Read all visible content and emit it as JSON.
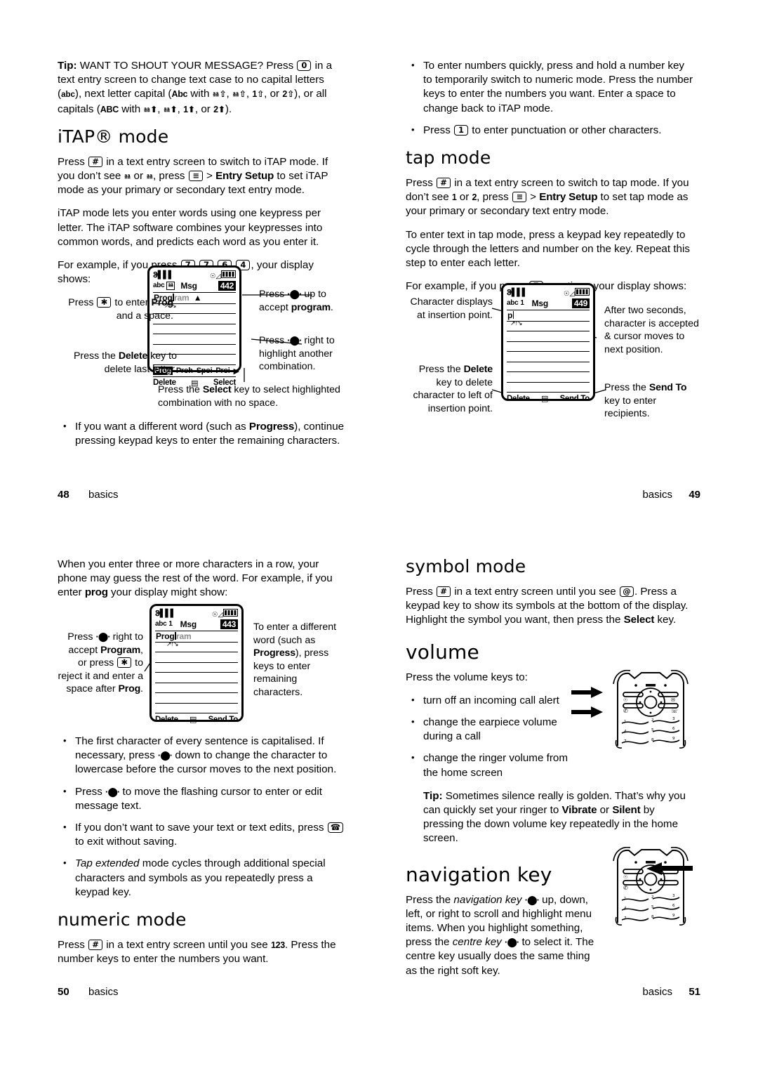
{
  "pages": [
    {
      "left": {
        "tip_label": "Tip:",
        "tip_text_1": " WANT TO SHOUT YOUR MESSAGE? Press ",
        "tip_key_0": "0",
        "tip_text_2": " in a text entry screen to change text case to no capital letters (",
        "tip_abc": "abc",
        "tip_text_3": "), next letter capital (",
        "tip_Abc": "Abc",
        "tip_text_4": " with ",
        "tip_text_5": "), or all capitals (",
        "tip_ABC": "ABC",
        "tip_text_6": " with ",
        "tip_text_7": ").",
        "heading_itap": "iTAP® mode",
        "p1_a": "Press ",
        "p1_key_hash": "#",
        "p1_b": " in a text entry screen to switch to iTAP mode. If you don’t see ",
        "p1_c": " or ",
        "p1_d": ", press ",
        "p1_menu": "☰",
        "p1_e": " > ",
        "p1_entrysetup": "Entry Setup",
        "p1_f": " to set iTAP mode as your primary or secondary text entry mode.",
        "p2": "iTAP mode lets you enter words using one keypress per letter. The iTAP software combines your keypresses into common words, and predicts each word as you enter it.",
        "p3_a": "For example, if you press ",
        "p3_keys": [
          "7",
          "7",
          "6",
          "4"
        ],
        "p3_b": ", your display shows:",
        "figure": {
          "status_signal": "ᴵ▂▄▆",
          "status_alert": "♩◀))",
          "mode": "abc",
          "mode_icon": "iTAP",
          "msg_label": "Msg",
          "char_count": "442",
          "typed_text": "Prog",
          "predicted_text": "ram",
          "word_list": [
            "Prog",
            "Proh",
            "Spoi",
            "Proi"
          ],
          "word_list_selected": "Prog",
          "softkey_left": "Delete",
          "softkey_right": "Select",
          "callout_left_top_a": "Press ",
          "callout_left_top_key": "✱",
          "callout_left_top_b": " to enter ",
          "callout_left_top_bold": "Prog",
          "callout_left_top_c": " and a space.",
          "callout_left_bottom_a": "Press the ",
          "callout_left_bottom_bold": "Delete",
          "callout_left_bottom_b": " key to delete last letter.",
          "callout_right_top_a": "Press ",
          "callout_right_top_b": " up to accept ",
          "callout_right_top_bold": "program",
          "callout_right_top_c": ".",
          "callout_right_mid_a": "Press ",
          "callout_right_mid_b": " right to highlight another combination.",
          "callout_bottom_a": "Press the ",
          "callout_bottom_bold": "Select",
          "callout_bottom_b": " key to select highlighted combination with no space."
        },
        "bullet1_a": "If you want a different word (such as ",
        "bullet1_bold": "Progress",
        "bullet1_b": "), continue pressing keypad keys to enter the remaining characters."
      },
      "right": {
        "bullet1": "To enter numbers quickly, press and hold a number key to temporarily switch to numeric mode. Press the number keys to enter the numbers you want. Enter a space to change back to iTAP mode.",
        "bullet2_a": "Press ",
        "bullet2_key": "1",
        "bullet2_b": " to enter punctuation or other characters.",
        "heading_tap": "tap mode",
        "p1_a": "Press ",
        "p1_key_hash": "#",
        "p1_b": " in a text entry screen to switch to tap mode. If you don’t see ",
        "p1_one": "1",
        "p1_c": " or ",
        "p1_two": "2",
        "p1_d": ", press ",
        "p1_e": " > ",
        "p1_entrysetup": "Entry Setup",
        "p1_f": " to set tap mode as your primary or secondary text entry mode.",
        "p2": "To enter text in tap mode, press a keypad key repeatedly to cycle through the letters and number on the key. Repeat this step to enter each letter.",
        "p3_a": "For example, if you press ",
        "p3_key": "7",
        "p3_b": " one time, your display shows:",
        "figure": {
          "mode": "abc",
          "mode_icon": "1",
          "msg_label": "Msg",
          "char_count": "449",
          "typed_text": "p",
          "softkey_left": "Delete",
          "softkey_right": "Send To",
          "callout_left_top": "Character displays at insertion point.",
          "callout_left_bottom_a": "Press the ",
          "callout_left_bottom_bold": "Delete",
          "callout_left_bottom_b": " key to delete character to left of insertion point.",
          "callout_right_top": "After two seconds, character is accepted & cursor moves to next position.",
          "callout_right_bottom_a": "Press the ",
          "callout_right_bottom_bold": "Send To",
          "callout_right_bottom_b": " key to enter recipients."
        }
      },
      "footer": {
        "left_page": "48",
        "left_label": "basics",
        "right_label": "basics",
        "right_page": "49"
      }
    },
    {
      "left": {
        "p1_a": "When you enter three or more characters in a row, your phone may guess the rest of the word. For example, if you enter ",
        "p1_bold": "prog",
        "p1_b": " your display might show:",
        "figure": {
          "mode": "abc",
          "mode_icon": "1",
          "msg_label": "Msg",
          "char_count": "443",
          "typed_text": "Prog",
          "predicted_text": "ram",
          "softkey_left": "Delete",
          "softkey_right": "Send To",
          "callout_left_a": "Press ",
          "callout_left_b": " right to accept ",
          "callout_left_bold1": "Program",
          "callout_left_c": ", or press ",
          "callout_left_key": "✱",
          "callout_left_d": " to reject it and enter a space after ",
          "callout_left_bold2": "Prog",
          "callout_left_e": ".",
          "callout_right_a": "To enter a different word (such as ",
          "callout_right_bold": "Progress",
          "callout_right_b": "), press keys to enter remaining characters."
        },
        "bullet1_a": "The first character of every sentence is capitalised. If necessary, press ",
        "bullet1_b": " down to change the character to lowercase before the cursor moves to the next position.",
        "bullet2_a": "Press ",
        "bullet2_b": " to move the flashing cursor to enter or edit message text.",
        "bullet3_a": "If you don’t want to save your text or text edits, press ",
        "bullet3_b": " to exit without saving.",
        "bullet4_ital": "Tap extended",
        "bullet4_a": " mode cycles through additional special characters and symbols as you repeatedly press a keypad key.",
        "heading_numeric": "numeric mode",
        "p2_a": "Press ",
        "p2_key": "#",
        "p2_b": " in a text entry screen until you see ",
        "p2_bold": "123",
        "p2_c": ". Press the number keys to enter the numbers you want."
      },
      "right": {
        "heading_symbol": "symbol mode",
        "p1_a": "Press ",
        "p1_key": "#",
        "p1_b": " in a text entry screen until you see ",
        "p1_at": "@",
        "p1_c": ". Press a keypad key to show its symbols at the bottom of the display. Highlight the symbol you want, then press the ",
        "p1_bold": "Select",
        "p1_d": " key.",
        "heading_volume": "volume",
        "p2": "Press the volume keys to:",
        "bullet1": "turn off an incoming call alert",
        "bullet2": "change the earpiece volume during a call",
        "bullet3": "change the ringer volume from the home screen",
        "tip_label": "Tip:",
        "tip_a": " Sometimes silence really is golden. That’s why you can quickly set your ringer to ",
        "tip_bold1": "Vibrate",
        "tip_b": " or ",
        "tip_bold2": "Silent",
        "tip_c": " by pressing the down volume key repeatedly in the home screen.",
        "heading_nav": "navigation key",
        "p3_a": "Press the ",
        "p3_ital1": "navigation key",
        "p3_b": " up, down, left, or right to scroll and highlight menu items. When you highlight something, press the ",
        "p3_ital2": "centre key",
        "p3_c": " to select it. The centre key usually does the same thing as the right soft key.",
        "keypad_digits": [
          "1",
          "2 ABC",
          "DEF 3",
          "4 GHI",
          "5 JKL",
          "MNO 6",
          "7 PQRS",
          "8 TUV",
          "WXYZ 9"
        ]
      },
      "footer": {
        "left_page": "50",
        "left_label": "basics",
        "right_label": "basics",
        "right_page": "51"
      }
    }
  ]
}
